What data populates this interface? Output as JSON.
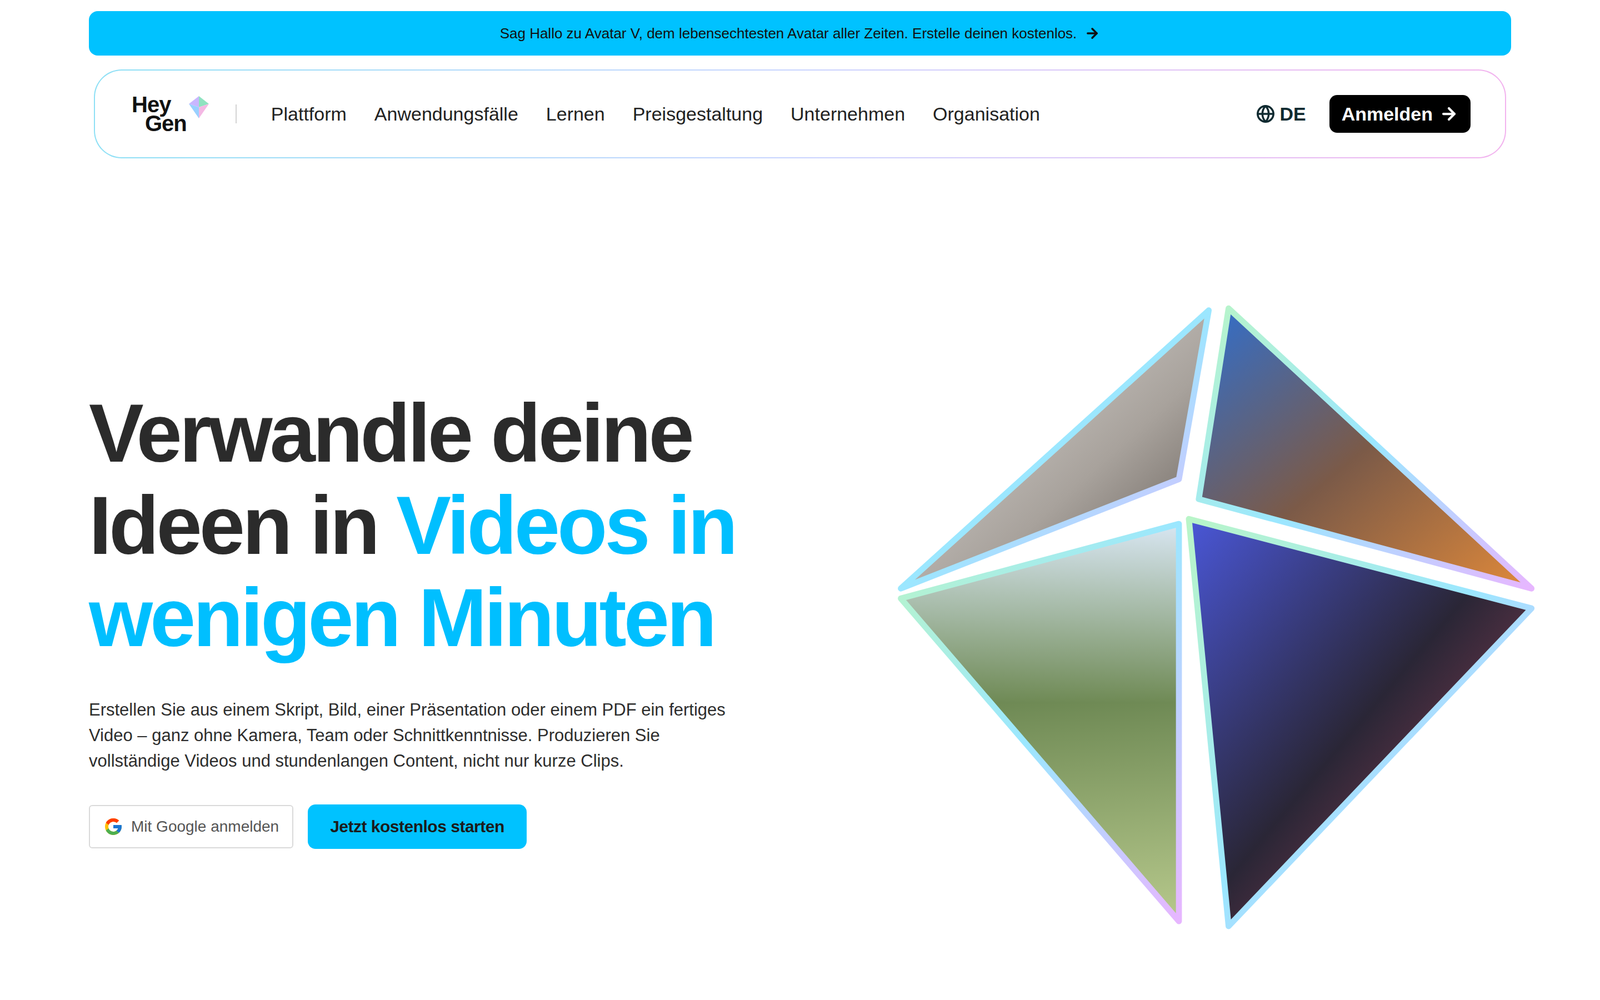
{
  "banner": {
    "text": "Sag Hallo zu Avatar V, dem lebensechtesten Avatar aller Zeiten. Erstelle deinen kostenlos."
  },
  "logo": {
    "line1": "Hey",
    "line2": "Gen"
  },
  "nav": {
    "items": [
      {
        "label": "Plattform"
      },
      {
        "label": "Anwendungsfälle"
      },
      {
        "label": "Lernen"
      },
      {
        "label": "Preisgestaltung"
      },
      {
        "label": "Unternehmen"
      },
      {
        "label": "Organisation"
      }
    ],
    "language": "DE",
    "login": "Anmelden"
  },
  "hero": {
    "headline": [
      {
        "segments": [
          {
            "text": "Verwandle deine",
            "accent": false
          }
        ]
      },
      {
        "segments": [
          {
            "text": "Ideen in",
            "accent": false
          },
          {
            "text": "Videos in",
            "accent": true
          }
        ]
      },
      {
        "segments": [
          {
            "text": "wenigen Minuten",
            "accent": true
          }
        ]
      }
    ],
    "description": "Erstellen Sie aus einem Skript, Bild, einer Präsentation oder einem PDF ein fertiges Video – ganz ohne Kamera, Team oder Schnittkenntnisse. Produzieren Sie vollständige Videos und stundenlangen Content, nicht nur kurze Clips.",
    "google_button": "Mit Google anmelden",
    "primary_button": "Jetzt kostenlos starten"
  }
}
